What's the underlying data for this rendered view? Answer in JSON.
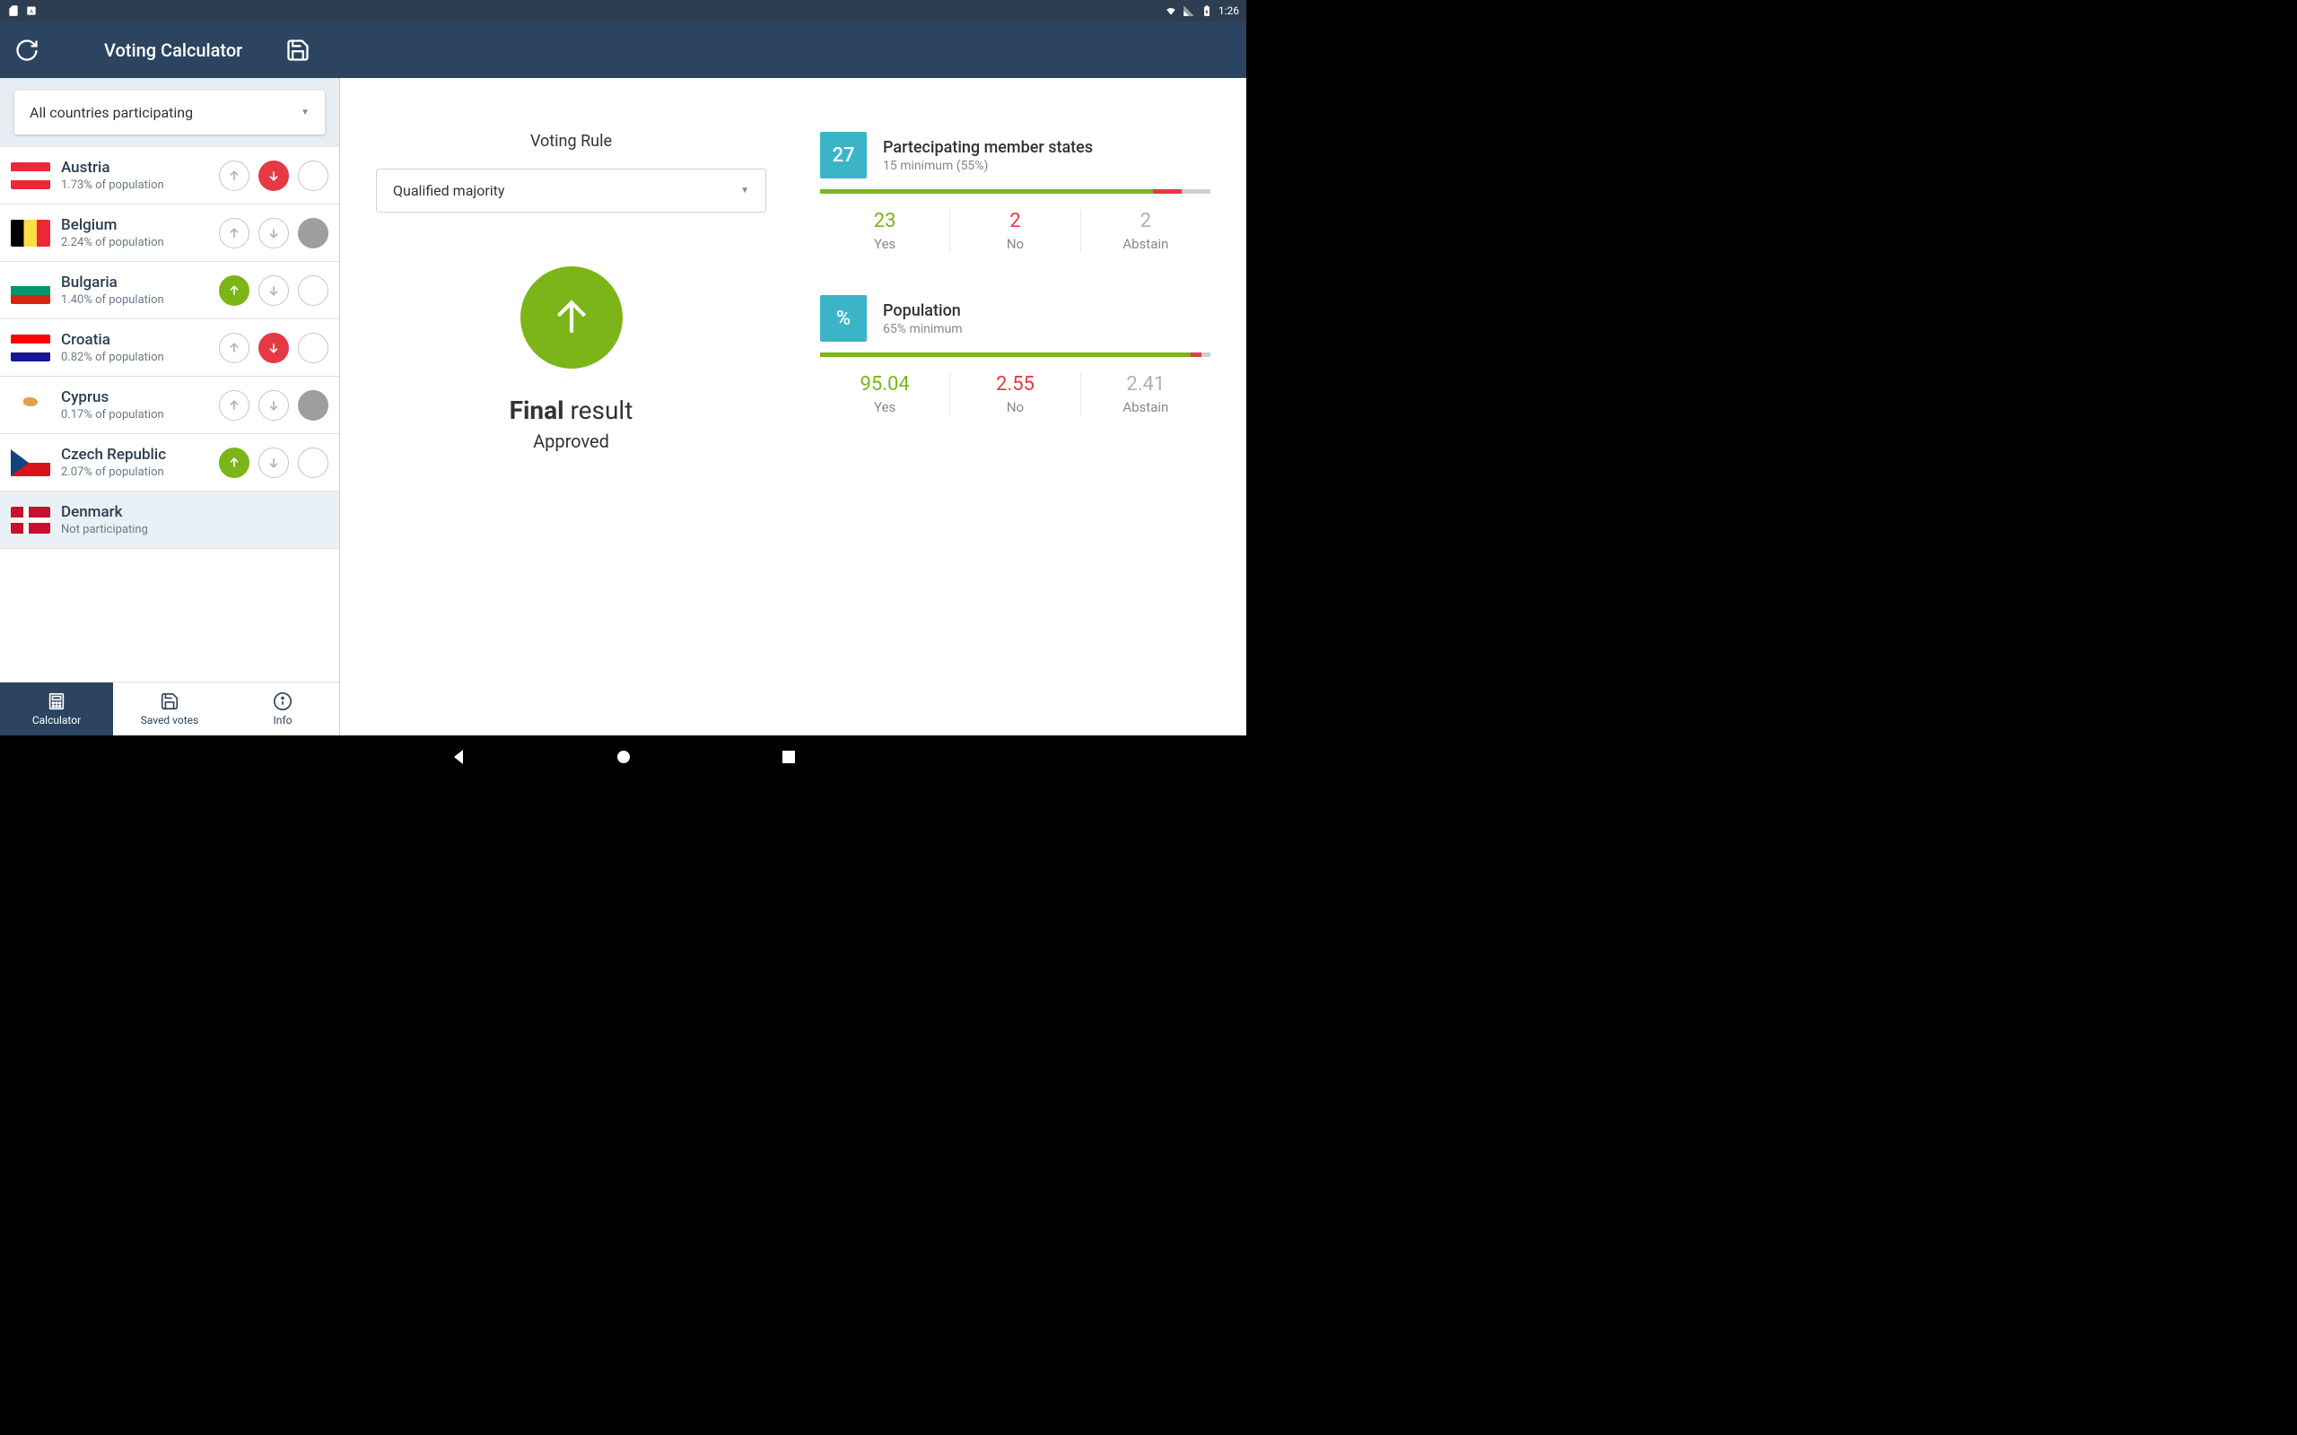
{
  "status_bar": {
    "time": "1:26"
  },
  "header": {
    "title": "Voting Calculator"
  },
  "sidebar": {
    "participation_select": "All countries participating",
    "countries": [
      {
        "name": "Austria",
        "sub": "1.73% of population",
        "flag": "flag-at",
        "vote": "no",
        "participating": true
      },
      {
        "name": "Belgium",
        "sub": "2.24% of population",
        "flag": "flag-be",
        "vote": "abstain",
        "participating": true
      },
      {
        "name": "Bulgaria",
        "sub": "1.40% of population",
        "flag": "flag-bg",
        "vote": "yes",
        "participating": true
      },
      {
        "name": "Croatia",
        "sub": "0.82% of population",
        "flag": "flag-hr",
        "vote": "no",
        "participating": true
      },
      {
        "name": "Cyprus",
        "sub": "0.17% of population",
        "flag": "flag-cy",
        "vote": "abstain",
        "participating": true
      },
      {
        "name": "Czech Republic",
        "sub": "2.07% of population",
        "flag": "flag-cz",
        "vote": "yes",
        "participating": true
      },
      {
        "name": "Denmark",
        "sub": "Not participating",
        "flag": "flag-dk",
        "vote": null,
        "participating": false
      }
    ]
  },
  "bottom_nav": {
    "items": [
      {
        "label": "Calculator",
        "active": true
      },
      {
        "label": "Saved votes",
        "active": false
      },
      {
        "label": "Info",
        "active": false
      }
    ]
  },
  "voting_rule": {
    "label": "Voting Rule",
    "value": "Qualified majority"
  },
  "result": {
    "label_bold": "Final",
    "label_rest": "result",
    "status": "Approved"
  },
  "metrics": {
    "states": {
      "badge": "27",
      "title": "Partecipating member states",
      "sub": "15 minimum (55%)",
      "yes": "23",
      "no": "2",
      "abstain": "2",
      "yes_pct": 85.2,
      "no_pct": 7.4,
      "abstain_pct": 7.4
    },
    "population": {
      "badge": "%",
      "title": "Population",
      "sub": "65% minimum",
      "yes": "95.04",
      "no": "2.55",
      "abstain": "2.41",
      "yes_pct": 95.04,
      "no_pct": 2.55,
      "abstain_pct": 2.41
    },
    "labels": {
      "yes": "Yes",
      "no": "No",
      "abstain": "Abstain"
    }
  }
}
